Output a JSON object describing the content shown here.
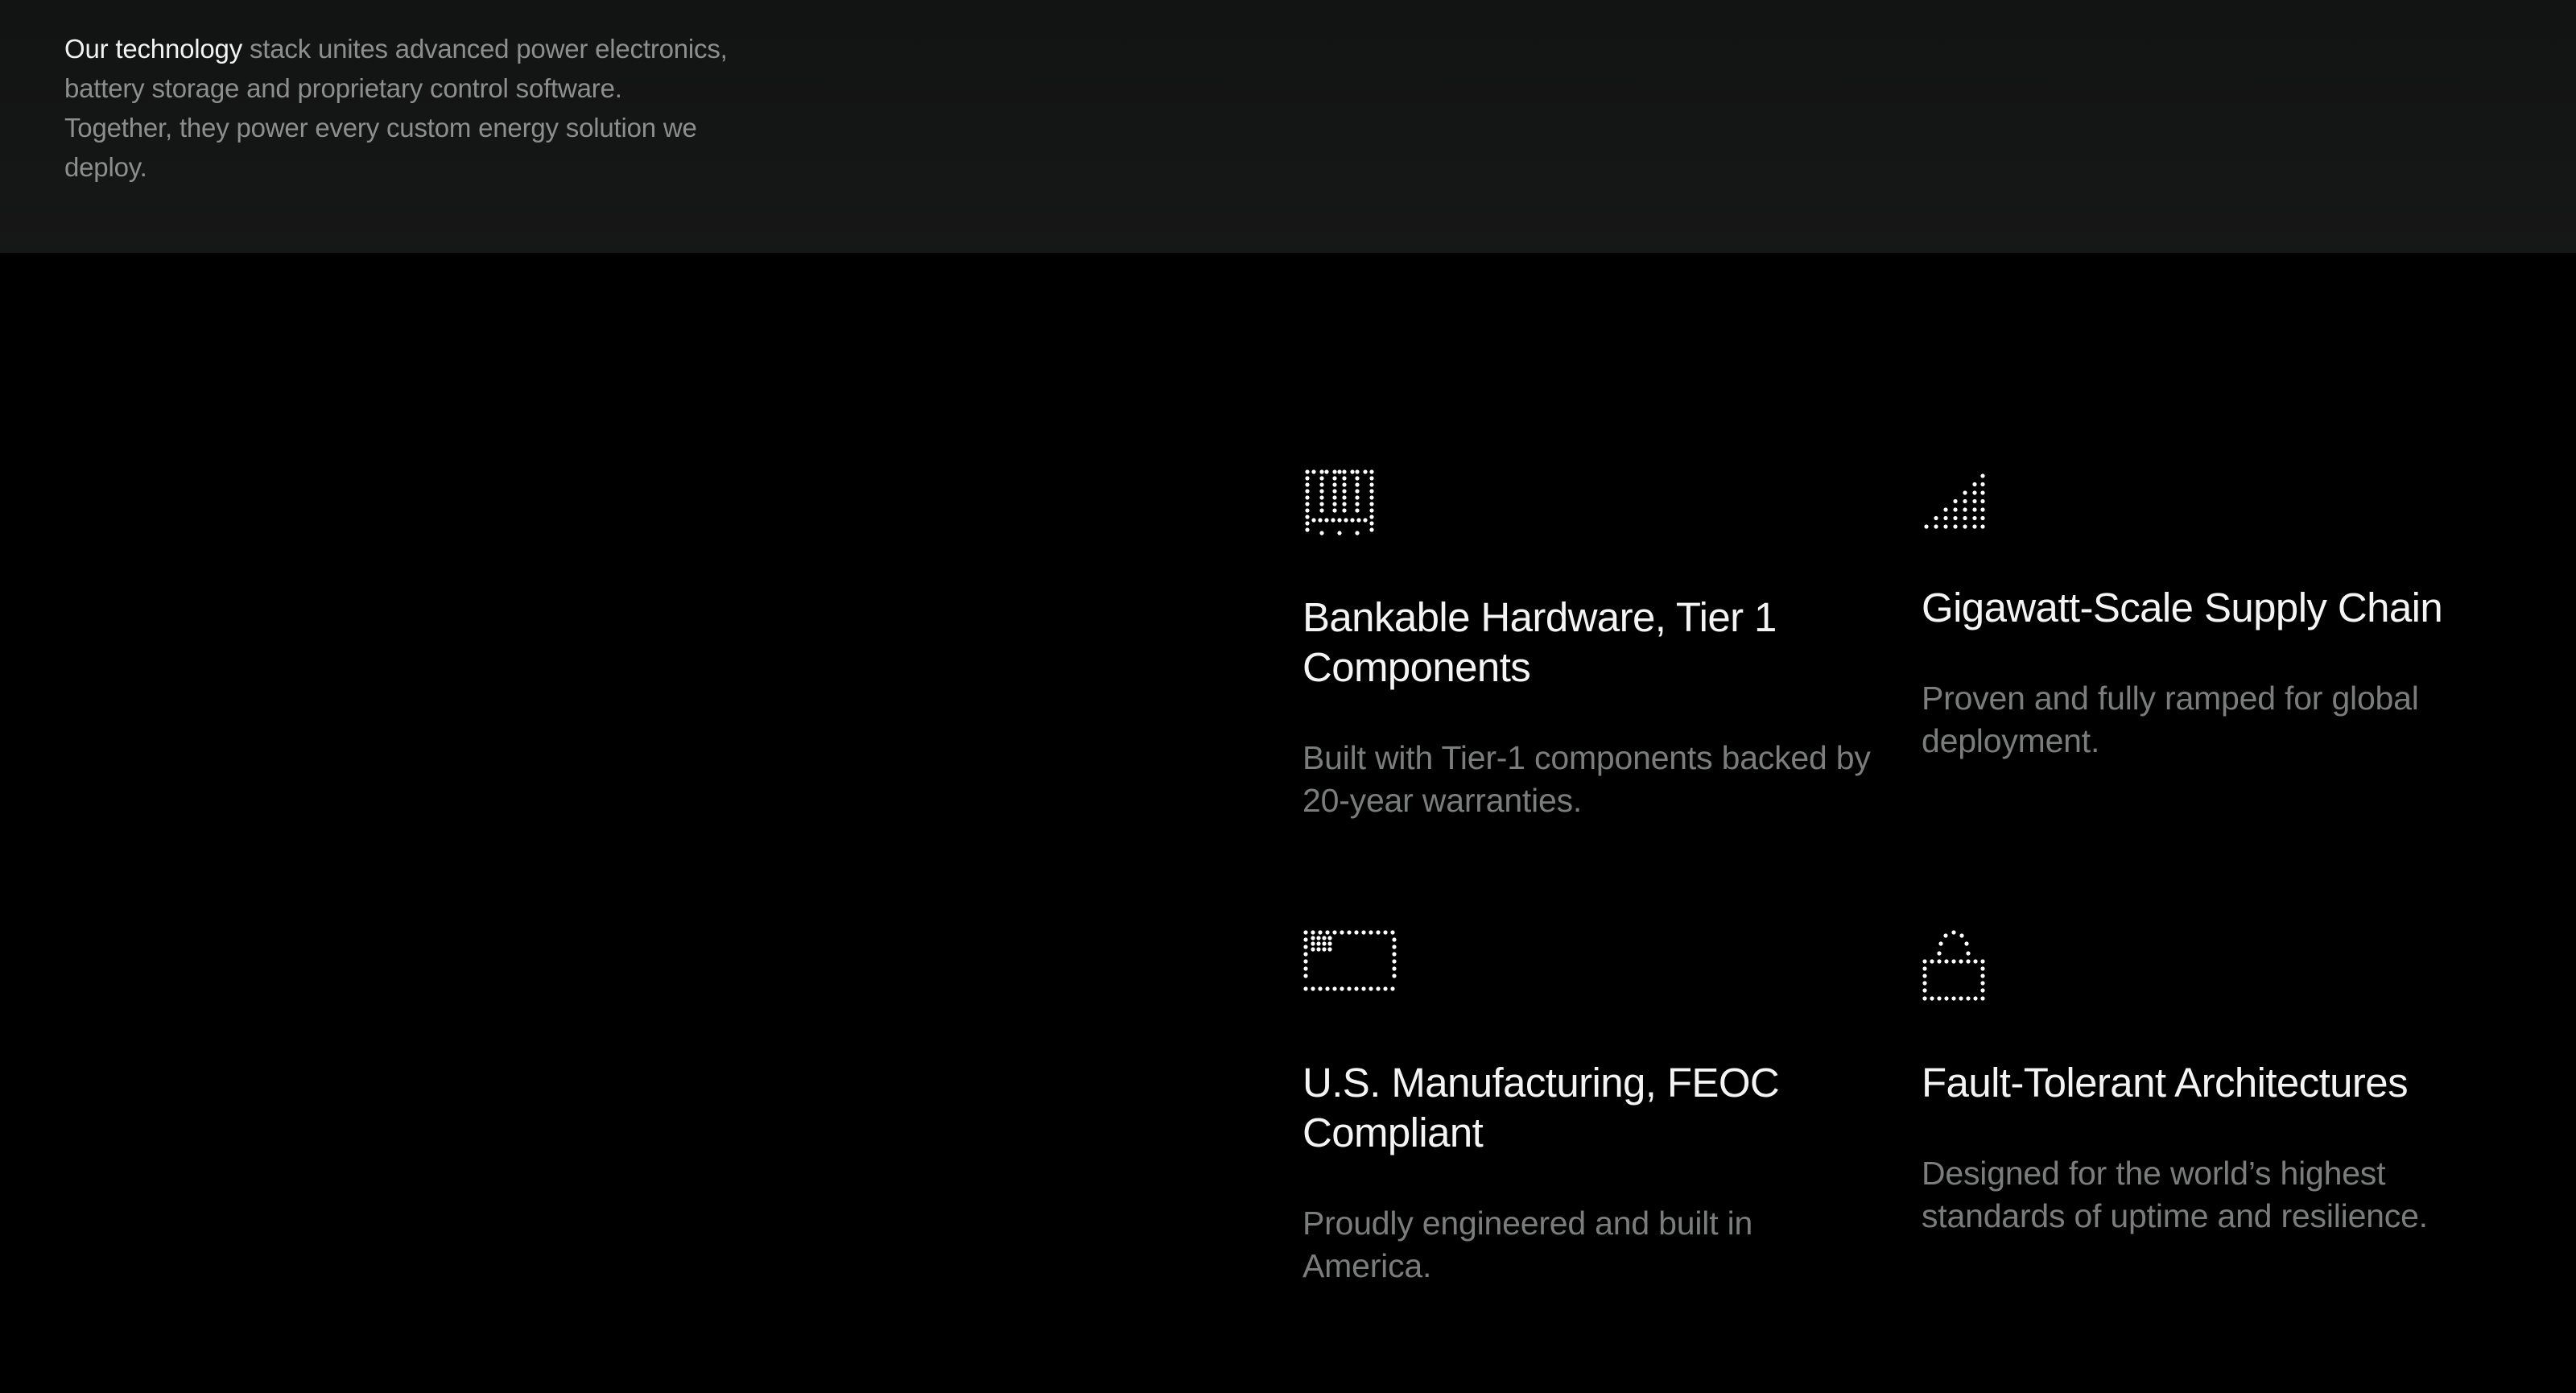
{
  "intro": {
    "lead": "Our technology",
    "rest": " stack unites advanced power electronics, battery storage and proprietary control software. Together, they power every custom energy solution we deploy."
  },
  "features": [
    {
      "icon": "hardware-grid-icon",
      "title": "Bankable Hardware, Tier 1 Components",
      "description": "Built with Tier-1 components backed by 20-year warranties."
    },
    {
      "icon": "signal-bars-icon",
      "title": "Gigawatt-Scale Supply Chain",
      "description": "Proven and fully ramped for global deployment."
    },
    {
      "icon": "factory-panel-icon",
      "title": "U.S. Manufacturing, FEOC Compliant",
      "description": "Proudly engineered and built in America."
    },
    {
      "icon": "shield-lock-icon",
      "title": "Fault-Tolerant Architectures",
      "description": "Designed for the world’s highest standards of uptime and resilience."
    }
  ],
  "colors": {
    "background": "#000000",
    "top_band": "#141515",
    "title_text": "#f4f4f4",
    "body_text": "#7b7d7d"
  }
}
